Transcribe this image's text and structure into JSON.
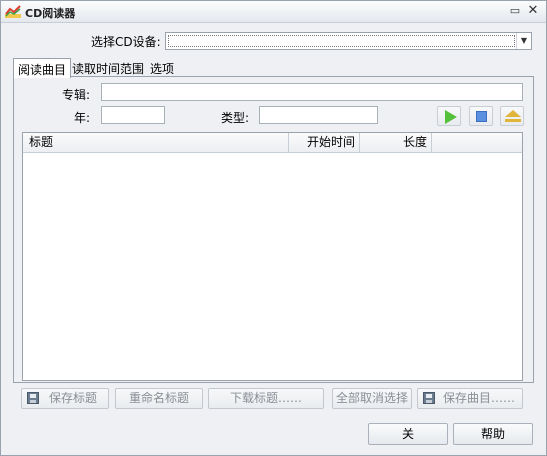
{
  "window": {
    "title": "CD阅读器",
    "restore_icon": "restore-icon",
    "close_icon": "close-icon"
  },
  "device": {
    "label": "选择CD设备:",
    "value": ""
  },
  "tabs": [
    {
      "label": "阅读曲目",
      "active": true
    },
    {
      "label": "读取时间范围",
      "active": false
    },
    {
      "label": "选项",
      "active": false
    }
  ],
  "form": {
    "album_label": "专辑:",
    "album_value": "",
    "year_label": "年:",
    "year_value": "",
    "genre_label": "类型:",
    "genre_value": ""
  },
  "transport": {
    "play_icon": "play-icon",
    "stop_icon": "stop-icon",
    "eject_icon": "eject-icon"
  },
  "tracklist": {
    "columns": [
      "标题",
      "开始时间",
      "长度"
    ],
    "rows": []
  },
  "actions": {
    "save_titles": "保存标题",
    "rename_titles": "重命名标题",
    "download_titles": "下载标题……",
    "deselect_all": "全部取消选择",
    "save_tracks": "保存曲目……"
  },
  "footer": {
    "close": "关",
    "help": "帮助"
  },
  "colors": {
    "play": "#55c03a",
    "stop": "#5b8fe0",
    "eject": "#e1b43a"
  }
}
